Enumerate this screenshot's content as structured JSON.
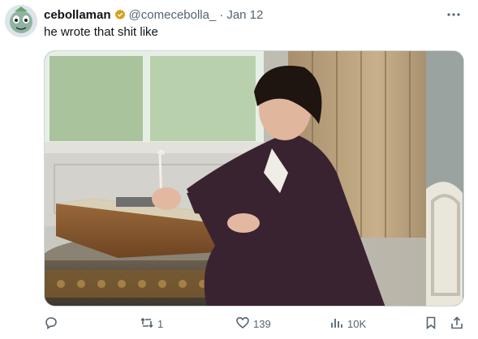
{
  "post": {
    "display_name": "cebollaman",
    "handle": "@comecebolla_",
    "separator": "·",
    "date": "Jan 12",
    "text": "he wrote that shit like",
    "verified_badge_icon": "gold-badge-icon",
    "more_icon": "more-dots-icon"
  },
  "actions": {
    "reply": {
      "icon": "reply-icon",
      "count": ""
    },
    "repost": {
      "icon": "repost-icon",
      "count": "1"
    },
    "like": {
      "icon": "heart-icon",
      "count": "139"
    },
    "views": {
      "icon": "views-icon",
      "count": "10K"
    },
    "bookmark": {
      "icon": "bookmark-icon"
    },
    "share": {
      "icon": "share-icon"
    }
  },
  "colors": {
    "text": "#0f1419",
    "secondary": "#536471",
    "badge": "#d4a017"
  }
}
